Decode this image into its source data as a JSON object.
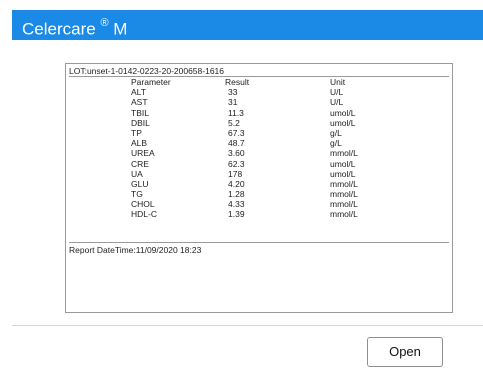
{
  "app": {
    "title": "Celercare",
    "title_mark": "®",
    "title_suffix": "M"
  },
  "report": {
    "lot": "LOT:unset-1-0142-0223-20-200658-1616",
    "headers": {
      "parameter": "Parameter",
      "result": "Result",
      "unit": "Unit"
    },
    "rows": [
      {
        "parameter": "ALT",
        "result": "33",
        "unit": "U/L"
      },
      {
        "parameter": "AST",
        "result": "31",
        "unit": "U/L"
      },
      {
        "parameter": "TBIL",
        "result": "11.3",
        "unit": "umol/L"
      },
      {
        "parameter": "DBIL",
        "result": "5.2",
        "unit": "umol/L"
      },
      {
        "parameter": "TP",
        "result": "67.3",
        "unit": "g/L"
      },
      {
        "parameter": "ALB",
        "result": "48.7",
        "unit": "g/L"
      },
      {
        "parameter": "UREA",
        "result": "3.60",
        "unit": "mmol/L"
      },
      {
        "parameter": "CRE",
        "result": "62.3",
        "unit": "umol/L"
      },
      {
        "parameter": "UA",
        "result": "178",
        "unit": "umol/L"
      },
      {
        "parameter": "GLU",
        "result": "4.20",
        "unit": "mmol/L"
      },
      {
        "parameter": "TG",
        "result": "1.28",
        "unit": "mmol/L"
      },
      {
        "parameter": "CHOL",
        "result": "4.33",
        "unit": "mmol/L"
      },
      {
        "parameter": "HDL-C",
        "result": "1.39",
        "unit": "mmol/L"
      }
    ],
    "report_datetime": "Report DateTime:11/09/2020 18:23"
  },
  "actions": {
    "open_label": "Open"
  },
  "colors": {
    "titlebar": "#1a8ae6",
    "title_text": "#ffffff",
    "border": "#9a9a9a"
  }
}
